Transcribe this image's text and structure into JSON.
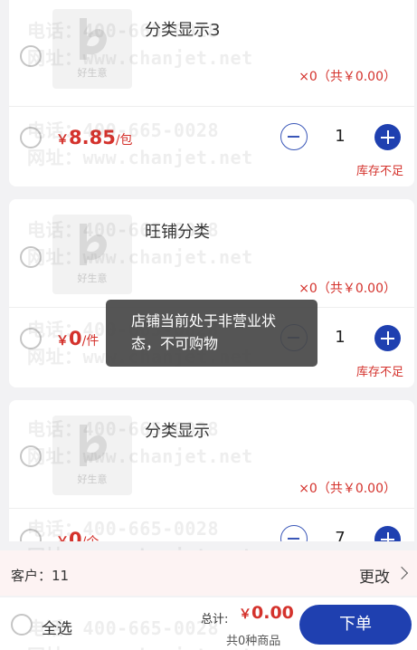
{
  "products": [
    {
      "name": "分类显示3",
      "qty_summary": "×0（共￥0.00）",
      "price_symbol": "￥",
      "price": "8.85",
      "unit": "/包",
      "quantity": "1",
      "stock_note": "库存不足"
    },
    {
      "name": "旺铺分类",
      "qty_summary": "×0（共￥0.00）",
      "price_symbol": "￥",
      "price": "0",
      "unit": "/件",
      "quantity": "1",
      "stock_note": "库存不足"
    },
    {
      "name": "分类显示",
      "qty_summary": "×0（共￥0.00）",
      "price_symbol": "￥",
      "price": "0",
      "unit": "/个",
      "quantity": "7",
      "stock_note": ""
    }
  ],
  "thumbnail": {
    "logo_text": "好生意",
    "icon": "haoshengyi-logo-icon"
  },
  "watermark": {
    "phone": "电话：400-665-0028",
    "site": "网址：www.chanjet.net"
  },
  "toast": {
    "message": "店铺当前处于非营业状态，不可购物"
  },
  "customer": {
    "label": "客户：",
    "value": "11",
    "change_label": "更改"
  },
  "footer": {
    "select_all": "全选",
    "total_label": "总计:",
    "total_symbol": "￥",
    "total": "0.00",
    "count": "共0种商品",
    "order_button": "下单"
  },
  "colors": {
    "accent": "#1f40b0",
    "price": "#d4322c",
    "customer_bar": "#fdf3f3"
  }
}
